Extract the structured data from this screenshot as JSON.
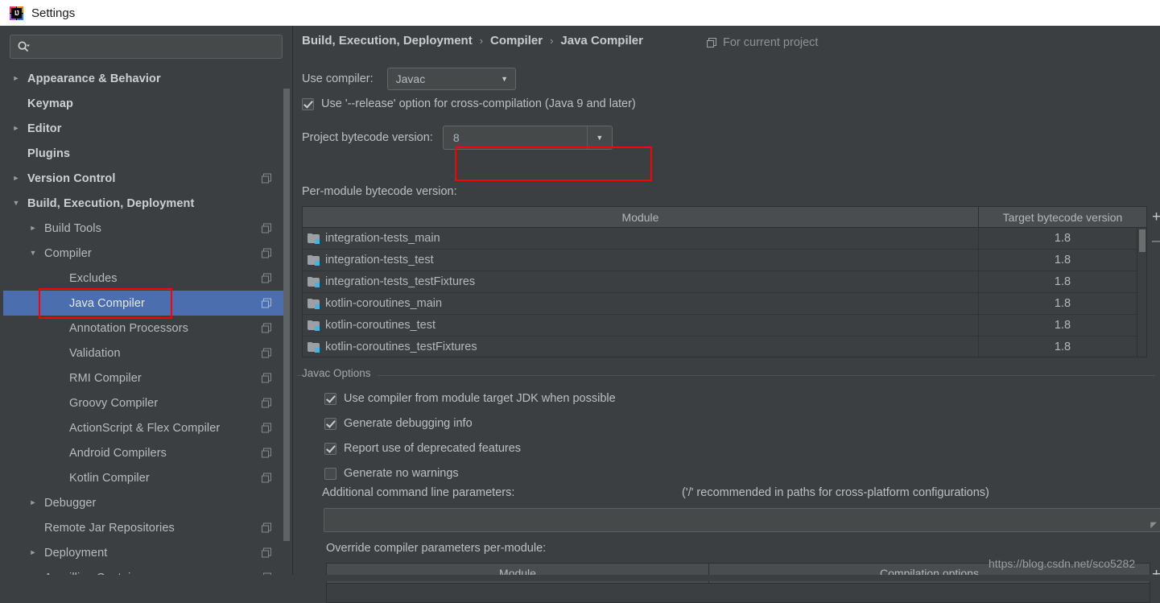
{
  "window": {
    "title": "Settings",
    "logo_text": "IJ",
    "logo_icon": "intellij-idea-logo"
  },
  "sidebar": {
    "search": {
      "placeholder": "",
      "value": "",
      "icon": "search-icon"
    },
    "items": [
      {
        "label": "Appearance & Behavior",
        "arrow": "collapsed",
        "bold": true,
        "indent": 8,
        "badge": false
      },
      {
        "label": "Keymap",
        "arrow": "none",
        "bold": true,
        "indent": 8,
        "badge": false
      },
      {
        "label": "Editor",
        "arrow": "collapsed",
        "bold": true,
        "indent": 8,
        "badge": false
      },
      {
        "label": "Plugins",
        "arrow": "none",
        "bold": true,
        "indent": 8,
        "badge": false
      },
      {
        "label": "Version Control",
        "arrow": "collapsed",
        "bold": true,
        "indent": 8,
        "badge": true
      },
      {
        "label": "Build, Execution, Deployment",
        "arrow": "expanded",
        "bold": true,
        "indent": 8,
        "badge": false
      },
      {
        "label": "Build Tools",
        "arrow": "collapsed",
        "bold": false,
        "indent": 29,
        "badge": true
      },
      {
        "label": "Compiler",
        "arrow": "expanded",
        "bold": false,
        "indent": 29,
        "badge": true
      },
      {
        "label": "Excludes",
        "arrow": "none",
        "bold": false,
        "indent": 60,
        "badge": true
      },
      {
        "label": "Java Compiler",
        "arrow": "none",
        "bold": false,
        "indent": 60,
        "badge": true,
        "selected": true
      },
      {
        "label": "Annotation Processors",
        "arrow": "none",
        "bold": false,
        "indent": 60,
        "badge": true
      },
      {
        "label": "Validation",
        "arrow": "none",
        "bold": false,
        "indent": 60,
        "badge": true
      },
      {
        "label": "RMI Compiler",
        "arrow": "none",
        "bold": false,
        "indent": 60,
        "badge": true
      },
      {
        "label": "Groovy Compiler",
        "arrow": "none",
        "bold": false,
        "indent": 60,
        "badge": true
      },
      {
        "label": "ActionScript & Flex Compiler",
        "arrow": "none",
        "bold": false,
        "indent": 60,
        "badge": true
      },
      {
        "label": "Android Compilers",
        "arrow": "none",
        "bold": false,
        "indent": 60,
        "badge": true
      },
      {
        "label": "Kotlin Compiler",
        "arrow": "none",
        "bold": false,
        "indent": 60,
        "badge": true
      },
      {
        "label": "Debugger",
        "arrow": "collapsed",
        "bold": false,
        "indent": 29,
        "badge": false
      },
      {
        "label": "Remote Jar Repositories",
        "arrow": "none",
        "bold": false,
        "indent": 29,
        "badge": true
      },
      {
        "label": "Deployment",
        "arrow": "collapsed",
        "bold": false,
        "indent": 29,
        "badge": true
      },
      {
        "label": "Arquillian Containers",
        "arrow": "none",
        "bold": false,
        "indent": 29,
        "badge": true
      }
    ]
  },
  "breadcrumb": {
    "items": [
      "Build, Execution, Deployment",
      "Compiler",
      "Java Compiler"
    ],
    "separator": "›"
  },
  "scope": {
    "label": "For current project",
    "icon": "copy-settings-icon"
  },
  "use_compiler": {
    "label": "Use compiler:",
    "value": "Javac",
    "arrow_icon": "chevron-down-icon"
  },
  "release_option": {
    "label": "Use '--release' option for cross-compilation (Java 9 and later)",
    "checked": true
  },
  "project_bytecode": {
    "label": "Project bytecode version:",
    "value": "8",
    "arrow_icon": "chevron-down-icon",
    "highlight_color": "#ff0000"
  },
  "per_module": {
    "label": "Per-module bytecode version:",
    "columns": [
      "Module",
      "Target bytecode version"
    ],
    "rows": [
      {
        "module": "integration-tests_main",
        "target": "1.8"
      },
      {
        "module": "integration-tests_test",
        "target": "1.8"
      },
      {
        "module": "integration-tests_testFixtures",
        "target": "1.8"
      },
      {
        "module": "kotlin-coroutines_main",
        "target": "1.8"
      },
      {
        "module": "kotlin-coroutines_test",
        "target": "1.8"
      },
      {
        "module": "kotlin-coroutines_testFixtures",
        "target": "1.8"
      }
    ],
    "add_button": "+",
    "remove_button": "–",
    "row_icon": "module-folder-icon"
  },
  "javac_options": {
    "group_title": "Javac Options",
    "checkboxes": [
      {
        "label": "Use compiler from module target JDK when possible",
        "checked": true
      },
      {
        "label": "Generate debugging info",
        "checked": true
      },
      {
        "label": "Report use of deprecated features",
        "checked": true
      },
      {
        "label": "Generate no warnings",
        "checked": false
      }
    ],
    "additional_params_label": "Additional command line parameters:",
    "additional_params_hint": "('/' recommended in paths for cross-platform configurations)",
    "additional_params_value": "",
    "override_label": "Override compiler parameters per-module:",
    "override_columns": [
      "Module",
      "Compilation options"
    ],
    "override_add_button": "+"
  },
  "watermark": "https://blog.csdn.net/sco5282",
  "colors": {
    "panel_bg": "#3c3f41",
    "selection": "#4b6eaf",
    "accent_red": "#ff0000",
    "text": "#bbbbbb",
    "input_bg": "#45494a"
  }
}
